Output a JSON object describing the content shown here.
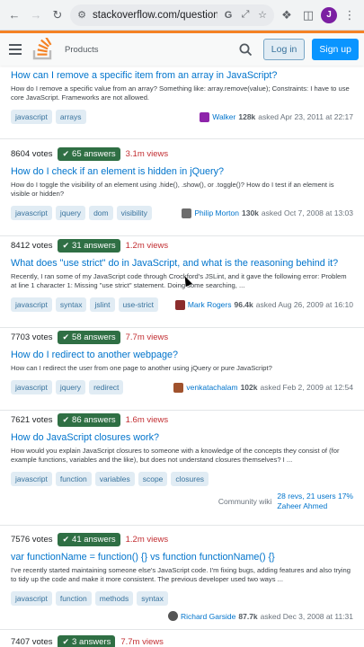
{
  "browser": {
    "url": "stackoverflow.com/question...",
    "profile_initial": "J"
  },
  "header": {
    "products": "Products",
    "login": "Log in",
    "signup": "Sign up"
  },
  "questions": [
    {
      "title": "How can I remove a specific item from an array in JavaScript?",
      "excerpt": "How do I remove a specific value from an array? Something like: array.remove(value); Constraints: I have to use core JavaScript. Frameworks are not allowed.",
      "tags": [
        "javascript",
        "arrays"
      ],
      "user": "Walker",
      "rep": "128k",
      "asked": "asked Apr 23, 2011 at 22:17",
      "avatar_color": "#8e24aa"
    },
    {
      "votes": "8604 votes",
      "answers": "65 answers",
      "views": "3.1m views",
      "title": "How do I check if an element is hidden in jQuery?",
      "excerpt": "How do I toggle the visibility of an element using .hide(), .show(), or .toggle()? How do I test if an element is visible or hidden?",
      "tags": [
        "javascript",
        "jquery",
        "dom",
        "visibility"
      ],
      "user": "Philip Morton",
      "rep": "130k",
      "asked": "asked Oct 7, 2008 at 13:03",
      "avatar_color": "#6d6d6d"
    },
    {
      "votes": "8412 votes",
      "answers": "31 answers",
      "views": "1.2m views",
      "title": "What does \"use strict\" do in JavaScript, and what is the reasoning behind it?",
      "excerpt": "Recently, I ran some of my JavaScript code through Crockford's JSLint, and it gave the following error: Problem at line 1 character 1: Missing \"use strict\" statement. Doing some searching, ...",
      "tags": [
        "javascript",
        "syntax",
        "jslint",
        "use-strict"
      ],
      "user": "Mark Rogers",
      "rep": "96.4k",
      "asked": "asked Aug 26, 2009 at 16:10",
      "avatar_color": "#8b2c2c"
    },
    {
      "votes": "7703 votes",
      "answers": "58 answers",
      "views": "7.7m views",
      "title": "How do I redirect to another webpage?",
      "excerpt": "How can I redirect the user from one page to another using jQuery or pure JavaScript?",
      "tags": [
        "javascript",
        "jquery",
        "redirect"
      ],
      "user": "venkatachalam",
      "rep": "102k",
      "asked": "asked Feb 2, 2009 at 12:54",
      "avatar_color": "#a0522d"
    },
    {
      "votes": "7621 votes",
      "answers": "86 answers",
      "views": "1.6m views",
      "title": "How do JavaScript closures work?",
      "excerpt": "How would you explain JavaScript closures to someone with a knowledge of the concepts they consist of (for example functions, variables and the like), but does not understand closures themselves? I ...",
      "tags": [
        "javascript",
        "function",
        "variables",
        "scope",
        "closures"
      ],
      "wiki": "Community wiki",
      "revs": "28 revs, 21 users 17%",
      "revs_user": "Zaheer Ahmed"
    },
    {
      "votes": "7576 votes",
      "answers": "41 answers",
      "views": "1.2m views",
      "title": "var functionName = function() {} vs function functionName() {}",
      "excerpt": "I've recently started maintaining someone else's JavaScript code. I'm fixing bugs, adding features and also trying to tidy up the code and make it more consistent. The previous developer used two ways ...",
      "tags": [
        "javascript",
        "function",
        "methods",
        "syntax"
      ],
      "user": "Richard Garside",
      "rep": "87.7k",
      "asked": "asked Dec 3, 2008 at 11:31",
      "avatar_color": "#555555"
    },
    {
      "votes": "7407 votes",
      "answers": "3 answers",
      "views": "7.7m views"
    }
  ],
  "colors": {
    "accent": "#f48225",
    "link": "#0074cc",
    "answered": "#2f6f44",
    "views": "#c22e32",
    "signup": "#0a95ff"
  }
}
